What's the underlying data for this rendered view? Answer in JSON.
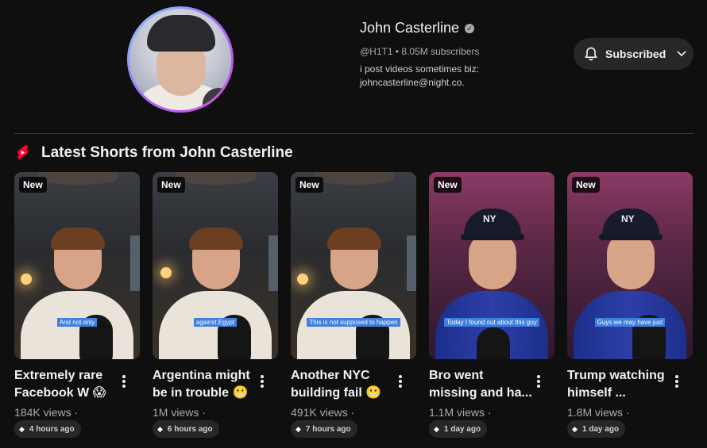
{
  "channel": {
    "name": "John Casterline",
    "verified_icon": "verified-check-icon",
    "handle_and_subs": "@H1T1 • 8.05M subscribers",
    "description_line1": "i post videos sometimes biz:",
    "description_line2": "johncasterline@night.co.",
    "subscribe_label": "Subscribed",
    "avatar_ring_colors": [
      "#7fd3ff",
      "#9b6bff",
      "#e24bd6"
    ]
  },
  "shorts_section": {
    "title": "Latest Shorts from John Casterline",
    "logo_icon": "shorts-icon",
    "logo_color": "#ff0033"
  },
  "shorts": [
    {
      "badge": "New",
      "caption": "And not only",
      "title": "Extremely rare Facebook W 😱",
      "views": "184K views ·",
      "ago": "4 hours ago",
      "style": "warm"
    },
    {
      "badge": "New",
      "caption": "against Egypt",
      "title": "Argentina might be in trouble 😬",
      "views": "1M views ·",
      "ago": "6 hours ago",
      "style": "warm"
    },
    {
      "badge": "New",
      "caption": "This is not supposed to happen",
      "title": "Another NYC building fail 😬",
      "views": "491K views ·",
      "ago": "7 hours ago",
      "style": "warm"
    },
    {
      "badge": "New",
      "caption": "Today I found out about this guy",
      "title": "Bro went missing and ha...",
      "views": "1.1M views ·",
      "ago": "1 day ago",
      "style": "pink"
    },
    {
      "badge": "New",
      "caption": "Guys we may have just",
      "title": "Trump watching himself ...",
      "views": "1.8M views ·",
      "ago": "1 day ago",
      "style": "pink"
    }
  ],
  "ui": {
    "cap_logo": "NY"
  }
}
